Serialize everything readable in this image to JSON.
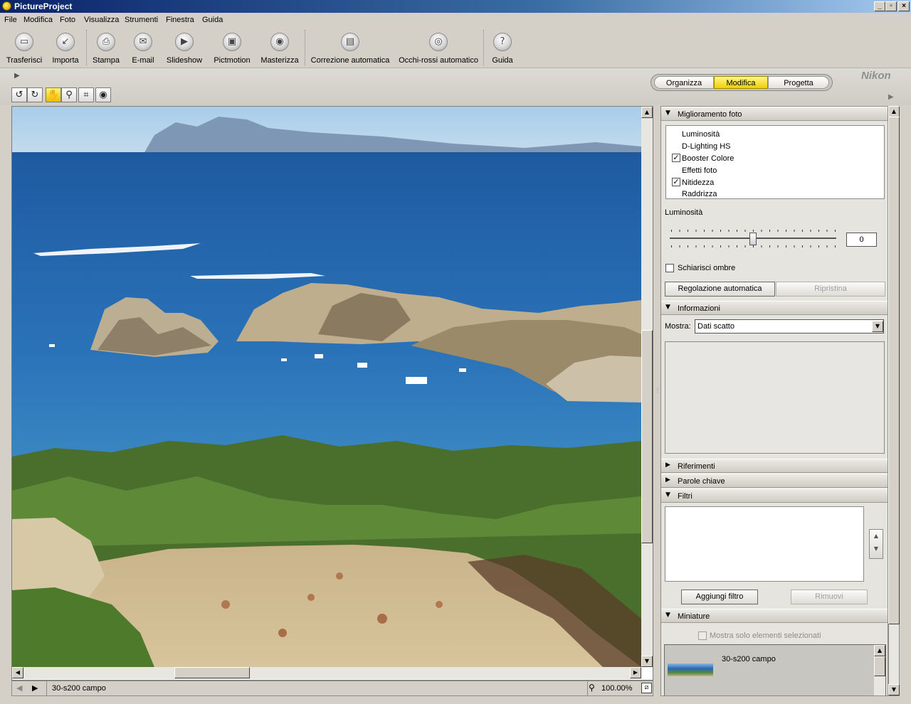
{
  "window": {
    "title": "PictureProject"
  },
  "menu": [
    "File",
    "Modifica",
    "Foto",
    "Visualizza",
    "Strumenti",
    "Finestra",
    "Guida"
  ],
  "toolbar": {
    "items": [
      {
        "label": "Trasferisci",
        "icon": "camera-transfer-icon"
      },
      {
        "label": "Importa",
        "icon": "import-icon"
      },
      {
        "label": "Stampa",
        "icon": "print-icon"
      },
      {
        "label": "E-mail",
        "icon": "email-icon"
      },
      {
        "label": "Slideshow",
        "icon": "slideshow-icon"
      },
      {
        "label": "Pictmotion",
        "icon": "pictmotion-icon"
      },
      {
        "label": "Masterizza",
        "icon": "burn-disc-icon"
      },
      {
        "label": "Correzione automatica",
        "icon": "auto-correct-icon"
      },
      {
        "label": "Occhi-rossi automatico",
        "icon": "red-eye-icon"
      },
      {
        "label": "Guida",
        "icon": "help-icon"
      }
    ]
  },
  "modes": {
    "items": [
      "Organizza",
      "Modifica",
      "Progetta"
    ],
    "active": "Modifica"
  },
  "brand": "Nikon",
  "enhance": {
    "title": "Miglioramento foto",
    "items": [
      {
        "label": "Luminosità",
        "checked": false
      },
      {
        "label": "D-Lighting HS",
        "checked": false
      },
      {
        "label": "Booster Colore",
        "checked": true
      },
      {
        "label": "Effetti foto",
        "checked": false
      },
      {
        "label": "Nitidezza",
        "checked": true
      },
      {
        "label": "Raddrizza",
        "checked": false
      }
    ],
    "brightness_label": "Luminosità",
    "brightness_value": "0",
    "brightness_level": 0.5,
    "shadow_label": "Schiarisci ombre",
    "auto_button": "Regolazione automatica",
    "reset_button": "Ripristina"
  },
  "info": {
    "title": "Informazioni",
    "show_label": "Mostra:",
    "show_value": "Dati scatto"
  },
  "references": {
    "title": "Riferimenti"
  },
  "keywords": {
    "title": "Parole chiave"
  },
  "filters": {
    "title": "Filtri",
    "add_button": "Aggiungi filtro",
    "remove_button": "Rimuovi"
  },
  "thumbnails": {
    "title": "Miniature",
    "only_selected_label": "Mostra solo elementi selezionati",
    "item_name": "30-s200 campo"
  },
  "status": {
    "filename": "30-s200 campo",
    "zoom": "100.00%"
  }
}
